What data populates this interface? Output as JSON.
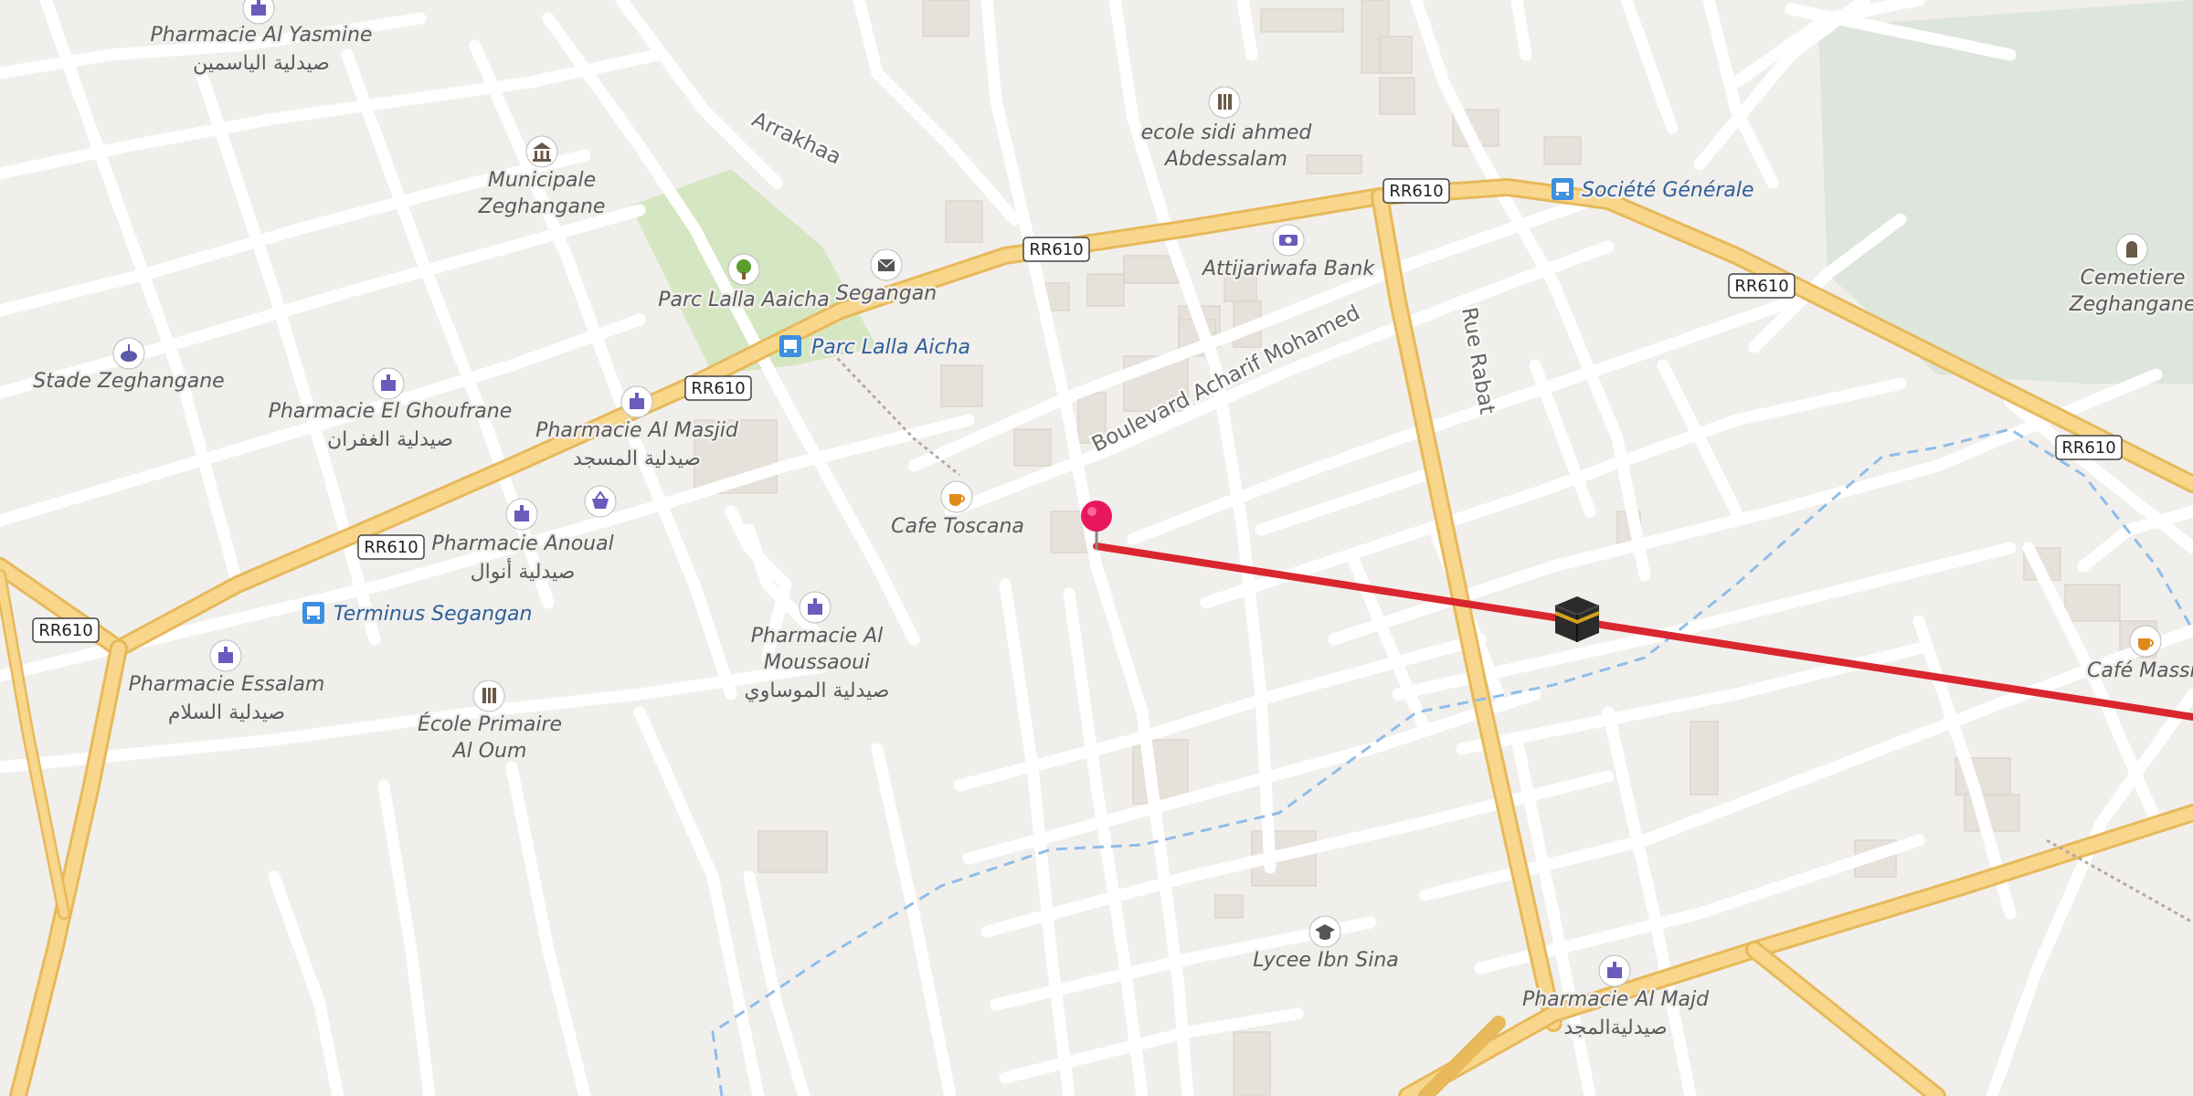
{
  "map": {
    "colors": {
      "background": "#f1efec",
      "road_minor": "#ffffff",
      "road_primary": "#f8d68c",
      "road_primary_casing": "#e7b95a",
      "park": "#d5e7c2",
      "cemetery": "#dde5dd",
      "building": "#e6e1da",
      "waterway": "#8fbde8",
      "route_line": "#d9262f",
      "pin": "#e8175d",
      "poi_icon": "#6a5cbd",
      "transit_icon": "#3d8fe0",
      "cafe_icon": "#e08a1a",
      "label_blue": "#2f5f9a"
    },
    "road_shields": [
      "RR610",
      "RR610",
      "RR610",
      "RR610",
      "RR610",
      "RR610",
      "RR610"
    ],
    "streets": {
      "arrakhaa": "Arrakhaa",
      "boulevard": "Boulevard Acharif Mohamed",
      "rue_rabat": "Rue Rabat"
    },
    "pois": {
      "pharmacie_yasmine": {
        "name": "Pharmacie Al Yasmine",
        "name_ar": "صيدلية الياسمين",
        "icon": "pharmacy-icon"
      },
      "municipale": {
        "name_line1": "Municipale",
        "name_line2": "Zeghangane",
        "icon": "townhall-icon"
      },
      "parc": {
        "name": "Parc Lalla Aaicha",
        "icon": "park-tree-icon"
      },
      "segangan_post": {
        "name": "Segangan",
        "icon": "post-office-icon"
      },
      "parc_bus": {
        "name": "Parc Lalla Aicha",
        "icon": "bus-stop-icon"
      },
      "stade": {
        "name": "Stade Zeghangane",
        "icon": "stadium-icon"
      },
      "pharmacie_ghoufrane": {
        "name": "Pharmacie El Ghoufrane",
        "name_ar": "صيدلية الغفران",
        "icon": "pharmacy-icon"
      },
      "pharmacie_masjid": {
        "name": "Pharmacie Al Masjid",
        "name_ar": "صيدلية المسجد",
        "icon": "pharmacy-icon"
      },
      "shop": {
        "icon": "shopping-basket-icon"
      },
      "pharmacie_anoual": {
        "name": "Pharmacie Anoual",
        "name_ar": "صيدلية أنوال",
        "icon": "pharmacy-icon"
      },
      "terminus": {
        "name": "Terminus Segangan",
        "icon": "bus-stop-icon"
      },
      "pharmacie_essalam": {
        "name": "Pharmacie Essalam",
        "name_ar": "صيدلية السلام",
        "icon": "pharmacy-icon"
      },
      "ecole_oum": {
        "name_line1": "École Primaire",
        "name_line2": "Al Oum",
        "icon": "school-icon"
      },
      "cafe_toscana": {
        "name": "Cafe Toscana",
        "icon": "cafe-icon"
      },
      "pharmacie_moussaoui": {
        "name_line1": "Pharmacie Al",
        "name_line2": "Moussaoui",
        "name_ar": "صيدلية الموساوي",
        "icon": "pharmacy-icon"
      },
      "ecole_sidi": {
        "name_line1": "ecole sidi ahmed",
        "name_line2": "Abdessalam",
        "icon": "school-icon"
      },
      "attijariwafa": {
        "name": "Attijariwafa Bank",
        "icon": "bank-icon"
      },
      "societe_generale": {
        "name": "Société Générale",
        "icon": "bus-stop-icon"
      },
      "cemetiere": {
        "name_line1": "Cemetiere",
        "name_line2": "Zeghangane",
        "icon": "cemetery-icon"
      },
      "cafe_massini": {
        "name": "Café Massini",
        "icon": "cafe-icon"
      },
      "lycee": {
        "name": "Lycee Ibn Sina",
        "icon": "graduation-cap-icon"
      },
      "pharmacie_majd": {
        "name": "Pharmacie Al Majd",
        "name_ar": "صيدليةالمجد",
        "icon": "pharmacy-icon"
      }
    },
    "markers": {
      "location_pin": {
        "icon": "location-pin-icon"
      },
      "qibla": {
        "icon": "kaaba-icon"
      }
    }
  }
}
